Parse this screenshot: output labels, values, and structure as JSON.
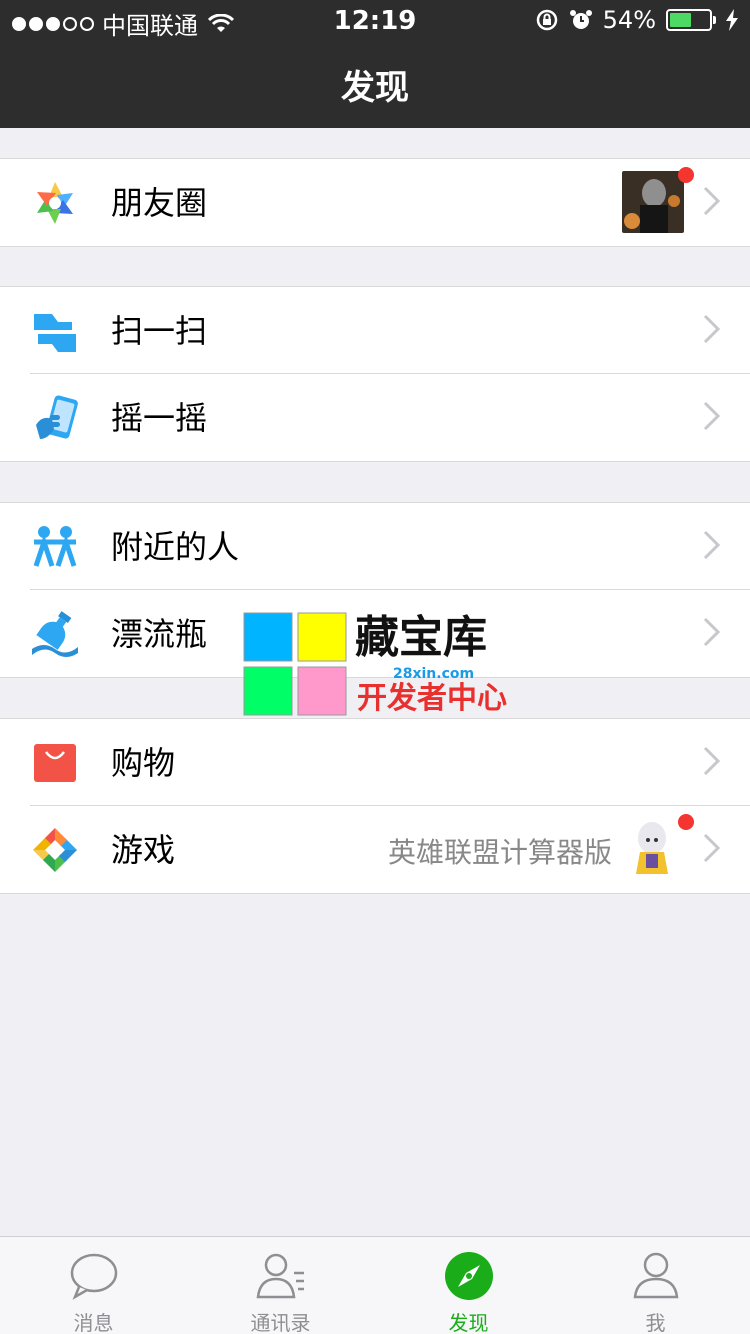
{
  "status_bar": {
    "carrier": "中国联通",
    "time": "12:19",
    "battery_percent": "54%",
    "battery_level": 0.54,
    "signal_bars": 3
  },
  "nav": {
    "title": "发现"
  },
  "groups": [
    {
      "items": [
        {
          "label": "朋友圈",
          "icon": "moments-icon",
          "has_thumbnail": true,
          "has_badge": true
        }
      ]
    },
    {
      "items": [
        {
          "label": "扫一扫",
          "icon": "scan-icon"
        },
        {
          "label": "摇一摇",
          "icon": "shake-icon"
        }
      ]
    },
    {
      "items": [
        {
          "label": "附近的人",
          "icon": "people-nearby-icon"
        },
        {
          "label": "漂流瓶",
          "icon": "drift-bottle-icon"
        }
      ]
    },
    {
      "items": [
        {
          "label": "购物",
          "icon": "shopping-bag-icon"
        },
        {
          "label": "游戏",
          "icon": "games-icon",
          "subtitle": "英雄联盟计算器版",
          "has_thumbnail": true,
          "has_badge": true
        }
      ]
    }
  ],
  "watermark": {
    "title": "藏宝库",
    "url": "28xin.com",
    "subtitle": "开发者中心"
  },
  "tabbar": {
    "active": 2,
    "tabs": [
      {
        "label": "消息",
        "icon": "chat-bubble-icon"
      },
      {
        "label": "通讯录",
        "icon": "contacts-icon"
      },
      {
        "label": "发现",
        "icon": "compass-icon"
      },
      {
        "label": "我",
        "icon": "profile-icon"
      }
    ]
  },
  "colors": {
    "header_bg": "#2d2d2d",
    "page_bg": "#efeff4",
    "accent_green": "#1aad19",
    "badge_red": "#f43530",
    "battery_green": "#4cd964"
  }
}
